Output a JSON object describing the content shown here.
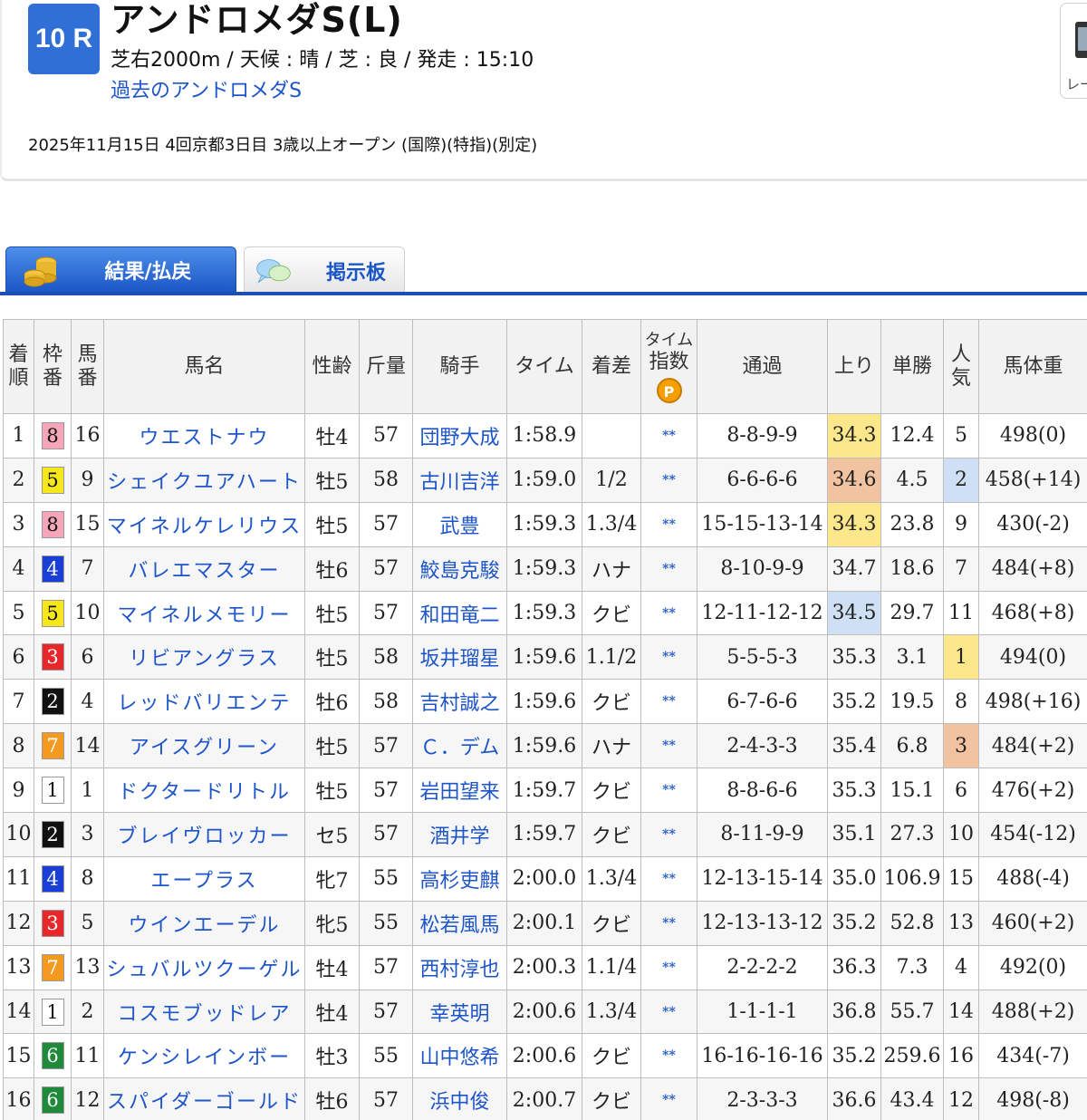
{
  "race": {
    "number": "10 R",
    "title": "アンドロメダS(L)",
    "info": "芝右2000m /  天候 : 晴 /  芝 : 良  /  発走 : 15:10",
    "past_link": "過去のアンドロメダS",
    "date_line": "2025年11月15日 4回京都3日目 3歳以上オープン  (国際)(特指)(別定)"
  },
  "side_widget": {
    "label": "レー"
  },
  "tabs": [
    {
      "label": "結果/払戻",
      "icon": "coins-icon"
    },
    {
      "label": "掲示板",
      "icon": "chat-bubble-icon"
    }
  ],
  "table": {
    "headers": {
      "rank": "着順",
      "waku": "枠番",
      "umaban": "馬番",
      "name": "馬名",
      "sexage": "性齢",
      "weight": "斤量",
      "jockey": "騎手",
      "time": "タイム",
      "margin": "着差",
      "time_index_top": "タイム",
      "time_index_bottom": "指数",
      "premium_badge": "P",
      "passing": "通過",
      "last3f": "上り",
      "odds": "単勝",
      "pop": "人気",
      "body": "馬体重"
    },
    "colors": {
      "waku1": "#ffffff",
      "waku2": "#111111",
      "waku3": "#e8272b",
      "waku4": "#1a3fd6",
      "waku5": "#f7e71a",
      "waku6": "#1e8a3a",
      "waku7": "#f59a1e",
      "waku8": "#f7a5b8",
      "highlight_yellow": "#fce88a",
      "highlight_orange": "#f1c3a0",
      "highlight_blue": "#cfe0f5"
    },
    "rows": [
      {
        "rank": "1",
        "waku": "8",
        "umaban": "16",
        "name": "ウエストナウ",
        "sexage": "牡4",
        "weight": "57",
        "jockey": "団野大成",
        "time": "1:58.9",
        "margin": "",
        "tidx": "**",
        "passing": "8-8-9-9",
        "last3f": "34.3",
        "odds": "12.4",
        "pop": "5",
        "body": "498(0)",
        "hl_last": "yellow",
        "hl_pop": ""
      },
      {
        "rank": "2",
        "waku": "5",
        "umaban": "9",
        "name": "シェイクユアハート",
        "sexage": "牡5",
        "weight": "58",
        "jockey": "古川吉洋",
        "time": "1:59.0",
        "margin": "1/2",
        "tidx": "**",
        "passing": "6-6-6-6",
        "last3f": "34.6",
        "odds": "4.5",
        "pop": "2",
        "body": "458(+14)",
        "hl_last": "orange",
        "hl_pop": "blue"
      },
      {
        "rank": "3",
        "waku": "8",
        "umaban": "15",
        "name": "マイネルケレリウス",
        "sexage": "牡5",
        "weight": "57",
        "jockey": "武豊",
        "time": "1:59.3",
        "margin": "1.3/4",
        "tidx": "**",
        "passing": "15-15-13-14",
        "last3f": "34.3",
        "odds": "23.8",
        "pop": "9",
        "body": "430(-2)",
        "hl_last": "yellow",
        "hl_pop": ""
      },
      {
        "rank": "4",
        "waku": "4",
        "umaban": "7",
        "name": "バレエマスター",
        "sexage": "牡6",
        "weight": "57",
        "jockey": "鮫島克駿",
        "time": "1:59.3",
        "margin": "ハナ",
        "tidx": "**",
        "passing": "8-10-9-9",
        "last3f": "34.7",
        "odds": "18.6",
        "pop": "7",
        "body": "484(+8)",
        "hl_last": "",
        "hl_pop": ""
      },
      {
        "rank": "5",
        "waku": "5",
        "umaban": "10",
        "name": "マイネルメモリー",
        "sexage": "牡5",
        "weight": "57",
        "jockey": "和田竜二",
        "time": "1:59.3",
        "margin": "クビ",
        "tidx": "**",
        "passing": "12-11-12-12",
        "last3f": "34.5",
        "odds": "29.7",
        "pop": "11",
        "body": "468(+8)",
        "hl_last": "blue",
        "hl_pop": ""
      },
      {
        "rank": "6",
        "waku": "3",
        "umaban": "6",
        "name": "リビアングラス",
        "sexage": "牡5",
        "weight": "58",
        "jockey": "坂井瑠星",
        "time": "1:59.6",
        "margin": "1.1/2",
        "tidx": "**",
        "passing": "5-5-5-3",
        "last3f": "35.3",
        "odds": "3.1",
        "pop": "1",
        "body": "494(0)",
        "hl_last": "",
        "hl_pop": "yellow"
      },
      {
        "rank": "7",
        "waku": "2",
        "umaban": "4",
        "name": "レッドバリエンテ",
        "sexage": "牡6",
        "weight": "58",
        "jockey": "吉村誠之",
        "time": "1:59.6",
        "margin": "クビ",
        "tidx": "**",
        "passing": "6-7-6-6",
        "last3f": "35.2",
        "odds": "19.5",
        "pop": "8",
        "body": "498(+16)",
        "hl_last": "",
        "hl_pop": ""
      },
      {
        "rank": "8",
        "waku": "7",
        "umaban": "14",
        "name": "アイスグリーン",
        "sexage": "牡5",
        "weight": "57",
        "jockey": "Ｃ．デム",
        "time": "1:59.6",
        "margin": "ハナ",
        "tidx": "**",
        "passing": "2-4-3-3",
        "last3f": "35.4",
        "odds": "6.8",
        "pop": "3",
        "body": "484(+2)",
        "hl_last": "",
        "hl_pop": "orange"
      },
      {
        "rank": "9",
        "waku": "1",
        "umaban": "1",
        "name": "ドクタードリトル",
        "sexage": "牡5",
        "weight": "57",
        "jockey": "岩田望来",
        "time": "1:59.7",
        "margin": "クビ",
        "tidx": "**",
        "passing": "8-8-6-6",
        "last3f": "35.3",
        "odds": "15.1",
        "pop": "6",
        "body": "476(+2)",
        "hl_last": "",
        "hl_pop": ""
      },
      {
        "rank": "10",
        "waku": "2",
        "umaban": "3",
        "name": "ブレイヴロッカー",
        "sexage": "セ5",
        "weight": "57",
        "jockey": "酒井学",
        "time": "1:59.7",
        "margin": "クビ",
        "tidx": "**",
        "passing": "8-11-9-9",
        "last3f": "35.1",
        "odds": "27.3",
        "pop": "10",
        "body": "454(-12)",
        "hl_last": "",
        "hl_pop": ""
      },
      {
        "rank": "11",
        "waku": "4",
        "umaban": "8",
        "name": "エープラス",
        "sexage": "牝7",
        "weight": "55",
        "jockey": "高杉吏麒",
        "time": "2:00.0",
        "margin": "1.3/4",
        "tidx": "**",
        "passing": "12-13-15-14",
        "last3f": "35.0",
        "odds": "106.9",
        "pop": "15",
        "body": "488(-4)",
        "hl_last": "",
        "hl_pop": ""
      },
      {
        "rank": "12",
        "waku": "3",
        "umaban": "5",
        "name": "ウインエーデル",
        "sexage": "牝5",
        "weight": "55",
        "jockey": "松若風馬",
        "time": "2:00.1",
        "margin": "クビ",
        "tidx": "**",
        "passing": "12-13-13-12",
        "last3f": "35.2",
        "odds": "52.8",
        "pop": "13",
        "body": "460(+2)",
        "hl_last": "",
        "hl_pop": ""
      },
      {
        "rank": "13",
        "waku": "7",
        "umaban": "13",
        "name": "シュバルツクーゲル",
        "sexage": "牡4",
        "weight": "57",
        "jockey": "西村淳也",
        "time": "2:00.3",
        "margin": "1.1/4",
        "tidx": "**",
        "passing": "2-2-2-2",
        "last3f": "36.3",
        "odds": "7.3",
        "pop": "4",
        "body": "492(0)",
        "hl_last": "",
        "hl_pop": ""
      },
      {
        "rank": "14",
        "waku": "1",
        "umaban": "2",
        "name": "コスモブッドレア",
        "sexage": "牡4",
        "weight": "57",
        "jockey": "幸英明",
        "time": "2:00.6",
        "margin": "1.3/4",
        "tidx": "**",
        "passing": "1-1-1-1",
        "last3f": "36.8",
        "odds": "55.7",
        "pop": "14",
        "body": "488(+2)",
        "hl_last": "",
        "hl_pop": ""
      },
      {
        "rank": "15",
        "waku": "6",
        "umaban": "11",
        "name": "ケンシレインボー",
        "sexage": "牡3",
        "weight": "55",
        "jockey": "山中悠希",
        "time": "2:00.6",
        "margin": "クビ",
        "tidx": "**",
        "passing": "16-16-16-16",
        "last3f": "35.2",
        "odds": "259.6",
        "pop": "16",
        "body": "434(-7)",
        "hl_last": "",
        "hl_pop": ""
      },
      {
        "rank": "16",
        "waku": "6",
        "umaban": "12",
        "name": "スパイダーゴールド",
        "sexage": "牡6",
        "weight": "57",
        "jockey": "浜中俊",
        "time": "2:00.7",
        "margin": "クビ",
        "tidx": "**",
        "passing": "2-3-3-3",
        "last3f": "36.6",
        "odds": "43.4",
        "pop": "12",
        "body": "498(-8)",
        "hl_last": "",
        "hl_pop": ""
      }
    ]
  }
}
